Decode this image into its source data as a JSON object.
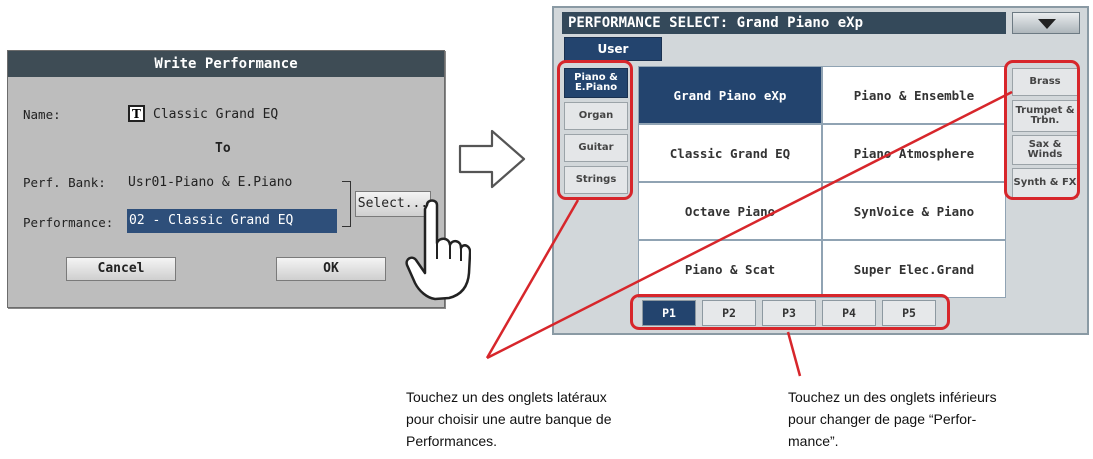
{
  "write_dialog": {
    "title": "Write Performance",
    "name_label": "Name:",
    "text_icon": "T",
    "name_value": "Classic Grand EQ",
    "to_label": "To",
    "bank_label": "Perf. Bank:",
    "bank_value": "Usr01-Piano & E.Piano",
    "perf_label": "Performance:",
    "perf_value": "02 - Classic Grand EQ",
    "select_label": "Select...",
    "cancel_label": "Cancel",
    "ok_label": "OK"
  },
  "perf_select": {
    "title": "PERFORMANCE SELECT: Grand Piano eXp",
    "user_tab": "User",
    "left_tabs": [
      "Piano & E.Piano",
      "Organ",
      "Guitar",
      "Strings"
    ],
    "right_tabs": [
      "Brass",
      "Trumpet & Trbn.",
      "Sax & Winds",
      "Synth & FX"
    ],
    "performances": [
      "Grand Piano eXp",
      "Piano & Ensemble",
      "Classic Grand EQ",
      "Piano Atmosphere",
      "Octave Piano",
      "SynVoice & Piano",
      "Piano & Scat",
      "Super Elec.Grand"
    ],
    "pages": [
      "P1",
      "P2",
      "P3",
      "P4",
      "P5"
    ]
  },
  "captions": {
    "left": [
      "Touchez un des onglets latéraux",
      "pour choisir une autre banque de",
      "Performances."
    ],
    "right": [
      "Touchez un des onglets inférieurs",
      "pour changer de page “Perfor-",
      "mance”."
    ]
  },
  "colors": {
    "highlight": "#d7262b",
    "selected": "#23446e",
    "dialog_title": "#3e4c55"
  },
  "icons": {
    "arrow": "right-arrow-icon",
    "hand": "pointing-hand-icon",
    "dropdown": "dropdown-triangle-icon"
  }
}
